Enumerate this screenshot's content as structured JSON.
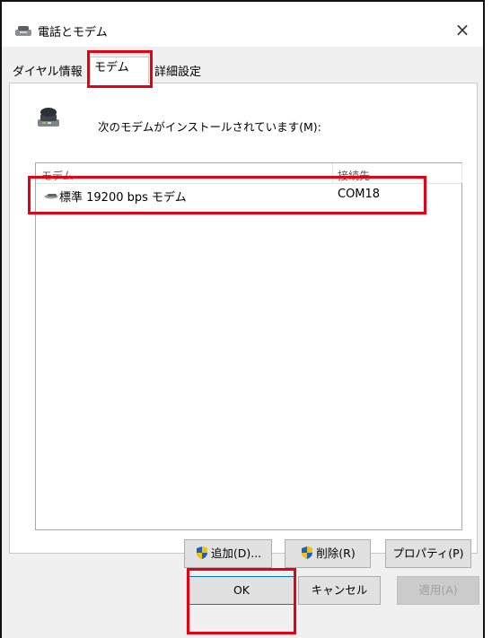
{
  "window": {
    "title": "電話とモデム",
    "close_glyph": "×"
  },
  "tabs": [
    {
      "label": "ダイヤル情報"
    },
    {
      "label": "モデム"
    },
    {
      "label": "詳細設定"
    }
  ],
  "modems_page": {
    "description": "次のモデムがインストールされています(M):",
    "list": {
      "columns": [
        "モデム",
        "接続先"
      ],
      "rows": [
        {
          "name": "標準 19200 bps モデム",
          "port": "COM18"
        }
      ]
    },
    "buttons": {
      "add": "追加(D)...",
      "remove": "削除(R)",
      "properties": "プロパティ(P)"
    }
  },
  "dialog_buttons": {
    "ok": "OK",
    "cancel": "キャンセル",
    "apply": "適用(A)"
  },
  "colors": {
    "highlight": "#e60012",
    "shield_blue": "#1f5fbf",
    "shield_yellow": "#f5c400"
  }
}
